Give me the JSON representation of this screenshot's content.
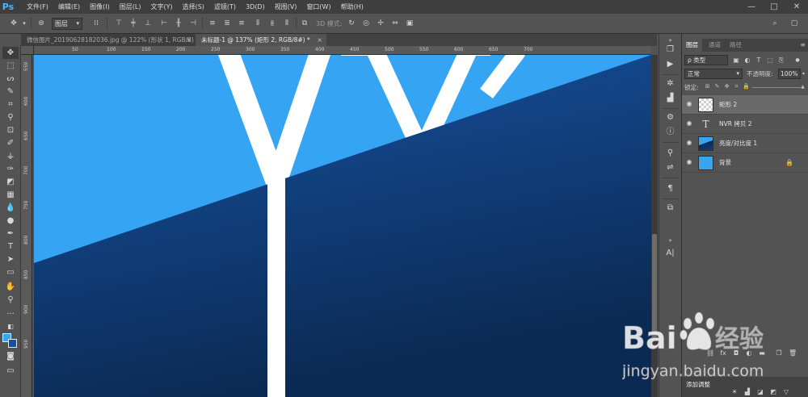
{
  "app": {
    "logo": "Ps",
    "menu": [
      "文件(F)",
      "编辑(E)",
      "图像(I)",
      "图层(L)",
      "文字(Y)",
      "选择(S)",
      "滤镜(T)",
      "3D(D)",
      "视图(V)",
      "窗口(W)",
      "帮助(H)"
    ],
    "window_controls": [
      "—",
      "□",
      "✕"
    ]
  },
  "options": {
    "auto_select_target": "图层",
    "mode3d": "3D 模式:"
  },
  "tabs": [
    {
      "label": "微信图片_20190628182036.jpg @ 122% (形状 1, RGB/8) *",
      "close": "×"
    },
    {
      "label": "未标题-1 @ 137% (矩形 2, RGB/8#) *",
      "close": "×"
    }
  ],
  "rulers": {
    "horizontal": [
      "50",
      "100",
      "150",
      "200",
      "250",
      "300",
      "350",
      "400",
      "450",
      "500",
      "550",
      "600",
      "650",
      "700"
    ],
    "vertical": [
      "550",
      "600",
      "650",
      "700",
      "750",
      "800",
      "850",
      "900",
      "950"
    ]
  },
  "canvas": {
    "text": "NVR",
    "colors": {
      "light": "#35a4f2",
      "dark_top": "#1653a3",
      "dark_bottom": "#0b2a53",
      "stroke": "#ffffff"
    }
  },
  "colors": {
    "foreground": "#35a4f2",
    "background": "#1451a4"
  },
  "panel": {
    "tabs": [
      "图层",
      "通道",
      "路径"
    ],
    "menu": "≡",
    "filter": "ρ 类型",
    "blend_mode": "正常",
    "opacity_label": "不透明度:",
    "opacity_value": "100%",
    "lock_label": "锁定:",
    "layers": [
      {
        "name": "矩形 2",
        "thumb": "checker",
        "selected": true,
        "locked": false
      },
      {
        "name": "NVR 拷贝 2",
        "thumb": "text",
        "selected": false,
        "locked": false
      },
      {
        "name": "亮度/对比度 1",
        "thumb": "gradient",
        "selected": false,
        "locked": false
      },
      {
        "name": "背景",
        "thumb": "blue",
        "selected": false,
        "locked": true
      }
    ],
    "adjustments_label": "添加调整"
  },
  "watermark": {
    "brand_left": "Bai",
    "brand_right": "经验",
    "url": "jingyan.baidu.com"
  }
}
